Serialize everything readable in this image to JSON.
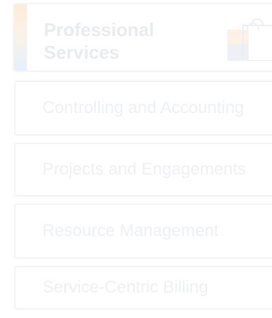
{
  "header": {
    "title": "Professional Services",
    "icon": "shopping-bag-icon",
    "accent_colors": [
      "#fdebd7",
      "#e6f0fb"
    ]
  },
  "menu": {
    "items": [
      {
        "label": "Controlling and Accounting"
      },
      {
        "label": "Projects and Engagements"
      },
      {
        "label": "Resource Management"
      },
      {
        "label": "Service-Centric Billing"
      }
    ]
  },
  "colors": {
    "text": "#eef0f3",
    "border": "#f2f3f5"
  }
}
